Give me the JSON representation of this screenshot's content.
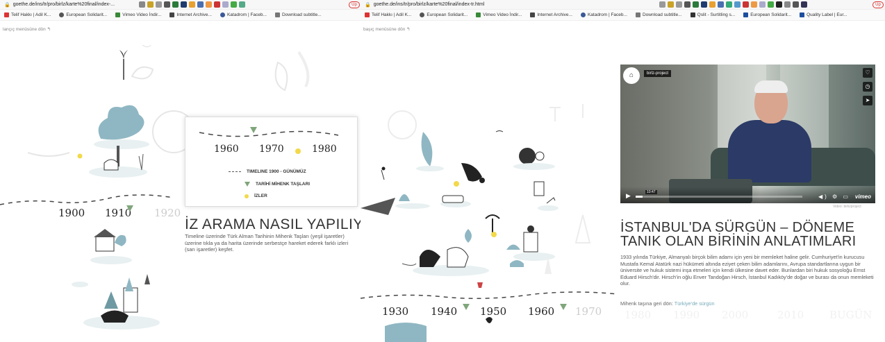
{
  "left": {
    "url": "goethe.de/ins/tr/pro/birlz/karte%20final/index-...",
    "bookmarks": [
      "Telif Hakkı | Adil K...",
      "European Solidarit...",
      "Vimeo Video İndir...",
      "Internet Archive...",
      "Katadrom | Faceb...",
      "Download subtitle..."
    ],
    "back_link": "lançıç menüsüne dön ↰",
    "up_label": "Up",
    "years_top": [
      "1960",
      "1970",
      "1980"
    ],
    "years_bottom": [
      "1900",
      "1910",
      "1920"
    ],
    "legend": {
      "timeline": "TIMELINE 1900 - GÜNÜMÜZ",
      "milestones": "TARİHİ MİHENK TAŞLARI",
      "traces": "İZLER"
    },
    "how_title": "İZ ARAMA NASIL YAPILIYOR?",
    "how_text": "Timeline üzerinde Türk Alman Tarihinin Mihenk Taşları (yeşil işaretler) üzerine tıkla ya da harita üzerinde serbestçe hareket ederek farklı izleri (sarı işaretler) keşfet."
  },
  "right": {
    "url": "goethe.de/ins/tr/pro/birlz/karte%20final/index-tr.html",
    "bookmarks": [
      "Telif Hakkı | Adil K...",
      "European Solidarit...",
      "Vimeo Video İndir...",
      "Internet Archive...",
      "Katadrom | Faceb...",
      "Download subtitle...",
      "Qslit - Surtitling s...",
      "European Solidarit...",
      "Quality Label | Eur..."
    ],
    "back_link": "başıç menüsüne dön ↰",
    "up_label": "Up",
    "years": [
      "1930",
      "1940",
      "1950",
      "1960",
      "1970"
    ],
    "video": {
      "channel": "birlz-project",
      "time": "10:47",
      "logo": "vimeo",
      "caption": "Video: birlizproject",
      "progress": 0.04
    },
    "exile_title": "İSTANBUL'DA SÜRGÜN – DÖNEME TANIK OLAN BİRİNİN ANLATIMLARI",
    "exile_text": "1933 yılında Türkiye, Almanyalı birçok bilim adamı için yeni bir memleket haline gelir. Cumhuriyet'in kurucusu Mustafa Kemal Atatürk nazi hükümeti altında eziyet çeken bilim adamlarını, Avrupa standartlarına uygun bir üniversite ve hukuk sistemi inşa etmeleri için kendi ülkesine davet eder. Bunlardan biri hukuk sosyoloğu Ernst Eduard Hirsch'dir. Hirsch'in oğlu Enver Tandoğan Hirsch, İstanbul Kadıköy'de doğar ve burası da onun memleketi olur.",
    "back_prefix": "Mihenk taşına geri dön:",
    "back_target": "Türkiye'de sürgün"
  },
  "colors": {
    "milestone": "#7fa67a",
    "trace": "#f2d94a",
    "accent": "#7ab"
  }
}
